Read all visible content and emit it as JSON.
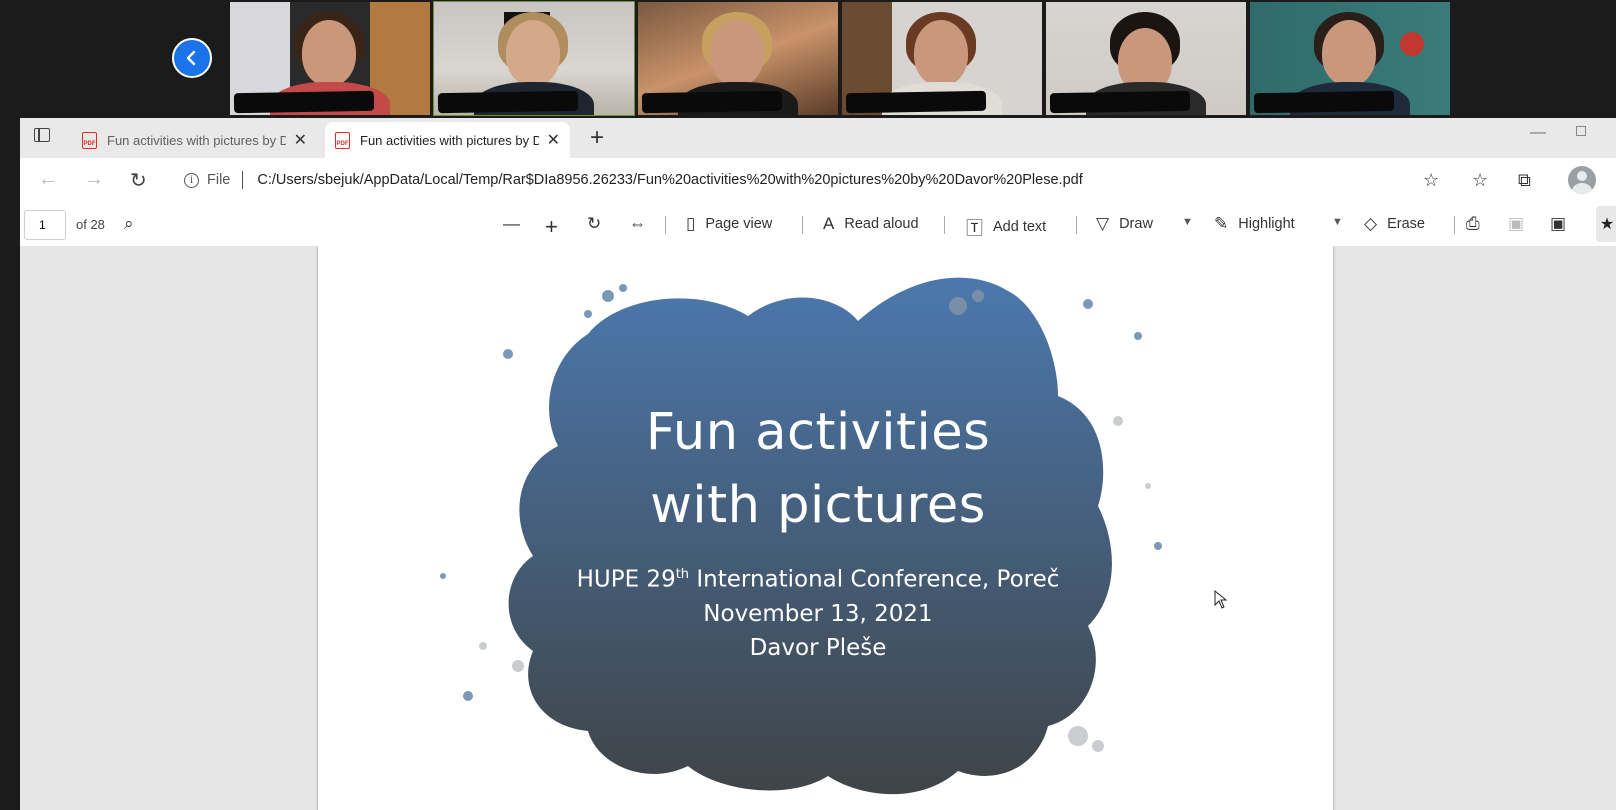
{
  "participants": {
    "tile_count": 6,
    "active_tile": 2
  },
  "browser": {
    "tabs": [
      {
        "title": "Fun activities with pictures by Davor Plese.pdf",
        "selected": false,
        "pdf_badge": "PDF"
      },
      {
        "title": "Fun activities with pictures by Davor Plese.pdf",
        "selected": true,
        "pdf_badge": "PDF"
      }
    ],
    "address": {
      "file_label": "File",
      "url": "C:/Users/sbejuk/AppData/Local/Temp/Rar$DIa8956.26233/Fun%20activities%20with%20pictures%20by%20Davor%20Plese.pdf"
    }
  },
  "pdf_toolbar": {
    "page_number": "1",
    "page_of": "of 28",
    "page_view": "Page view",
    "read_aloud": "Read aloud",
    "add_text": "Add text",
    "draw": "Draw",
    "highlight": "Highlight",
    "erase": "Erase"
  },
  "slide": {
    "title_line1": "Fun activities",
    "title_line2": "with pictures",
    "conf_prefix": "HUPE 29",
    "conf_sup": "th",
    "conf_suffix": " International Conference, Poreč",
    "date": "November 13, 2021",
    "author": "Davor Pleše"
  },
  "colors": {
    "blob_top": "#4b78ad",
    "blob_bottom": "#3f4447",
    "back_button": "#1a73e8"
  }
}
